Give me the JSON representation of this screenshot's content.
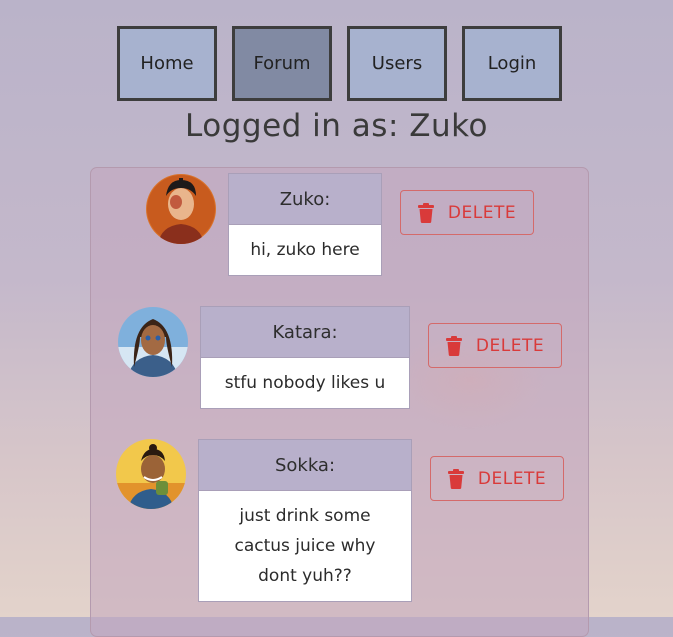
{
  "nav": {
    "items": [
      {
        "label": "Home"
      },
      {
        "label": "Forum"
      },
      {
        "label": "Users"
      },
      {
        "label": "Login"
      }
    ]
  },
  "status": {
    "logged_in_text": "Logged in as: Zuko"
  },
  "posts": [
    {
      "author": "Zuko:",
      "message": "hi, zuko here",
      "delete_label": "DELETE",
      "avatar_icon": "zuko-avatar"
    },
    {
      "author": "Katara:",
      "message": "stfu nobody likes u",
      "delete_label": "DELETE",
      "avatar_icon": "katara-avatar"
    },
    {
      "author": "Sokka:",
      "message": "just drink some cactus juice why dont yuh??",
      "delete_label": "DELETE",
      "avatar_icon": "sokka-avatar"
    }
  ],
  "colors": {
    "nav_button": "#a7b2cf",
    "nav_button_active": "#818aa3",
    "delete_accent": "#d93a3a",
    "card_header": "#b8b0cb"
  },
  "icons": {
    "delete": "trash-icon"
  }
}
